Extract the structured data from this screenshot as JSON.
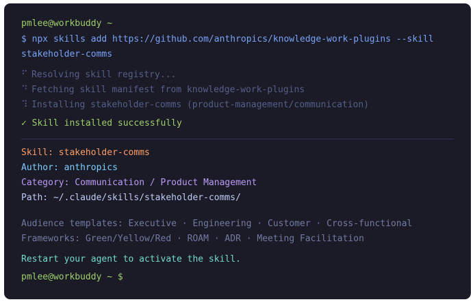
{
  "terminal": {
    "prompt_header": "pmlee@workbuddy ~",
    "command_line_1": "$ npx skills add https://github.com/anthropics/knowledge-work-plugins --skill",
    "command_line_2": "stakeholder-comms",
    "steps": [
      {
        "spinner": "⠋",
        "text": "Resolving skill registry..."
      },
      {
        "spinner": "⠙",
        "text": "Fetching skill manifest from knowledge-work-plugins"
      },
      {
        "spinner": "⠹",
        "text": "Installing stakeholder-comms (product-management/communication)"
      }
    ],
    "success": "✓ Skill installed successfully",
    "details": {
      "skill_label": "Skill:",
      "skill_value": "stakeholder-comms",
      "author_label": "Author:",
      "author_value": "anthropics",
      "category_label": "Category:",
      "category_value": "Communication / Product Management",
      "path_label": "Path:",
      "path_value": "~/.claude/skills/stakeholder-comms/"
    },
    "audience_templates": "Audience templates: Executive · Engineering · Customer · Cross-functional",
    "frameworks": "Frameworks: Green/Yellow/Red · ROAM · ADR · Meeting Facilitation",
    "restart_note": "Restart your agent to activate the skill.",
    "final_prompt": "pmlee@workbuddy ~ $"
  },
  "colors": {
    "background": "#1a1b26",
    "prompt": "#9ece6a",
    "command": "#7aa2f7",
    "skill_label": "#ff9e64",
    "author_label": "#7dcfff",
    "category_label": "#bb9af7",
    "restart": "#73daca"
  }
}
